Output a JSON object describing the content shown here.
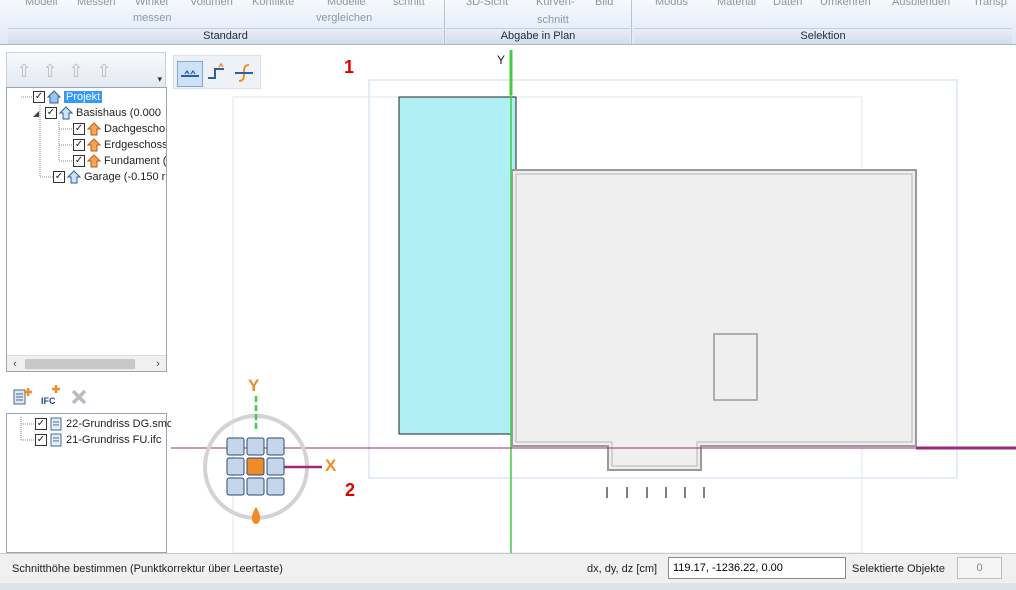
{
  "ribbon": {
    "top_items": [
      "Modell",
      "Messen",
      "Winkel",
      "Volumen",
      "Konflikte",
      "Modelle",
      "schnitt",
      "3D-Sicht",
      "Kurven-",
      "Bild",
      "Modus",
      "Material",
      "Daten",
      "Umkehren",
      "Ausblenden",
      "Transp"
    ],
    "messen_label": "messen",
    "vergleichen_label": "vergleichen",
    "schnitt_label": "schnitt",
    "groups": [
      "Standard",
      "Abgabe in Plan",
      "Selektion"
    ]
  },
  "tree": {
    "items": [
      {
        "label": "Projekt"
      },
      {
        "label": "Basishaus (0.000"
      },
      {
        "label": "Dachgescho"
      },
      {
        "label": "Erdgeschoss"
      },
      {
        "label": "Fundament ("
      },
      {
        "label": "Garage (-0.150 r"
      }
    ]
  },
  "files": {
    "ifc_label": "IFC",
    "items": [
      {
        "label": "22-Grundriss DG.smc"
      },
      {
        "label": "21-Grundriss FU.ifc"
      }
    ]
  },
  "canvas": {
    "y_axis_label": "Y",
    "gizmo_y_label": "Y",
    "gizmo_x_label": "X",
    "marker_1": "1",
    "marker_2": "2"
  },
  "status": {
    "message": "Schnitthöhe bestimmen (Punktkorrektur über Leertaste)",
    "coord_label": "dx, dy, dz [cm]",
    "coord_value": "119.17, -1236.22, 0.00",
    "selected_label": "Selektierte Objekte",
    "selected_count": "0"
  },
  "colors": {
    "accent_select": "#3399ff",
    "cyan_fill": "#aef0f4",
    "axis_green": "#44cc44",
    "axis_magenta": "#a0287a",
    "marker_red": "#e00000",
    "gizmo_orange": "#f08c28"
  }
}
